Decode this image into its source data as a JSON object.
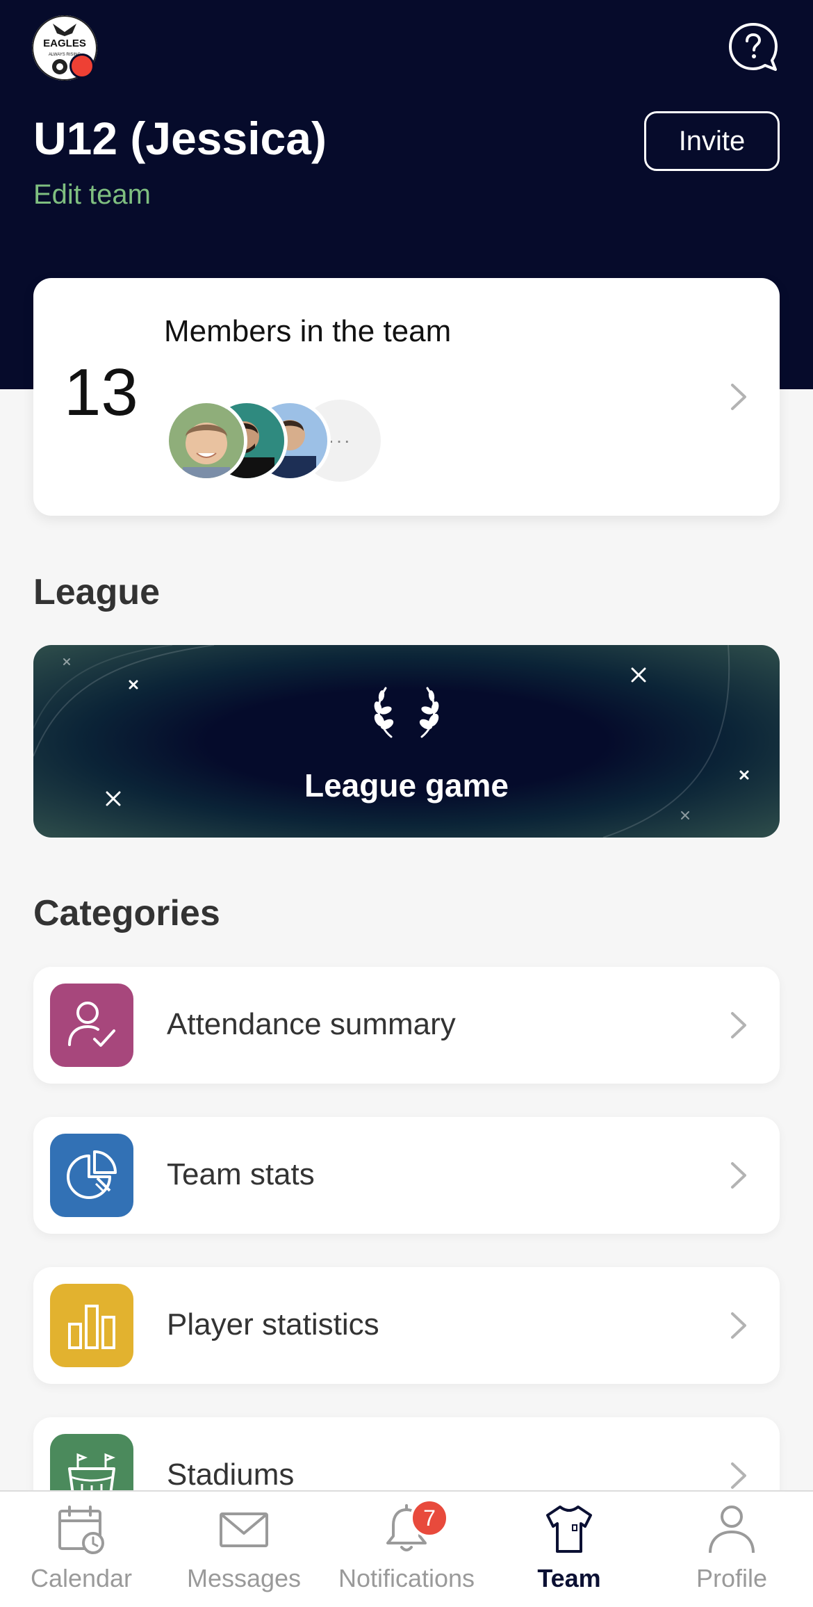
{
  "header": {
    "team_name": "U12 (Jessica)",
    "edit_label": "Edit team",
    "invite_label": "Invite",
    "logo": {
      "text_top": "EAGLES",
      "text_bottom": "ALWAYS RISING"
    }
  },
  "members": {
    "count": "13",
    "title": "Members in the team",
    "more_label": "···"
  },
  "league": {
    "section_title": "League",
    "card_label": "League game"
  },
  "categories": {
    "section_title": "Categories",
    "items": [
      {
        "label": "Attendance summary",
        "icon": "attendance-icon",
        "color": "#a7477c"
      },
      {
        "label": "Team stats",
        "icon": "pie-chart-icon",
        "color": "#3271b5"
      },
      {
        "label": "Player statistics",
        "icon": "bar-chart-icon",
        "color": "#e2b22f"
      },
      {
        "label": "Stadiums",
        "icon": "stadium-icon",
        "color": "#4b8a5c"
      }
    ]
  },
  "tabbar": {
    "items": [
      {
        "label": "Calendar",
        "icon": "calendar-icon"
      },
      {
        "label": "Messages",
        "icon": "envelope-icon"
      },
      {
        "label": "Notifications",
        "icon": "bell-icon",
        "badge": "7"
      },
      {
        "label": "Team",
        "icon": "jersey-icon",
        "active": true
      },
      {
        "label": "Profile",
        "icon": "person-icon"
      }
    ]
  },
  "colors": {
    "header_bg": "#060b2b",
    "edit_link": "#7fbf80",
    "badge": "#e84a3c"
  }
}
